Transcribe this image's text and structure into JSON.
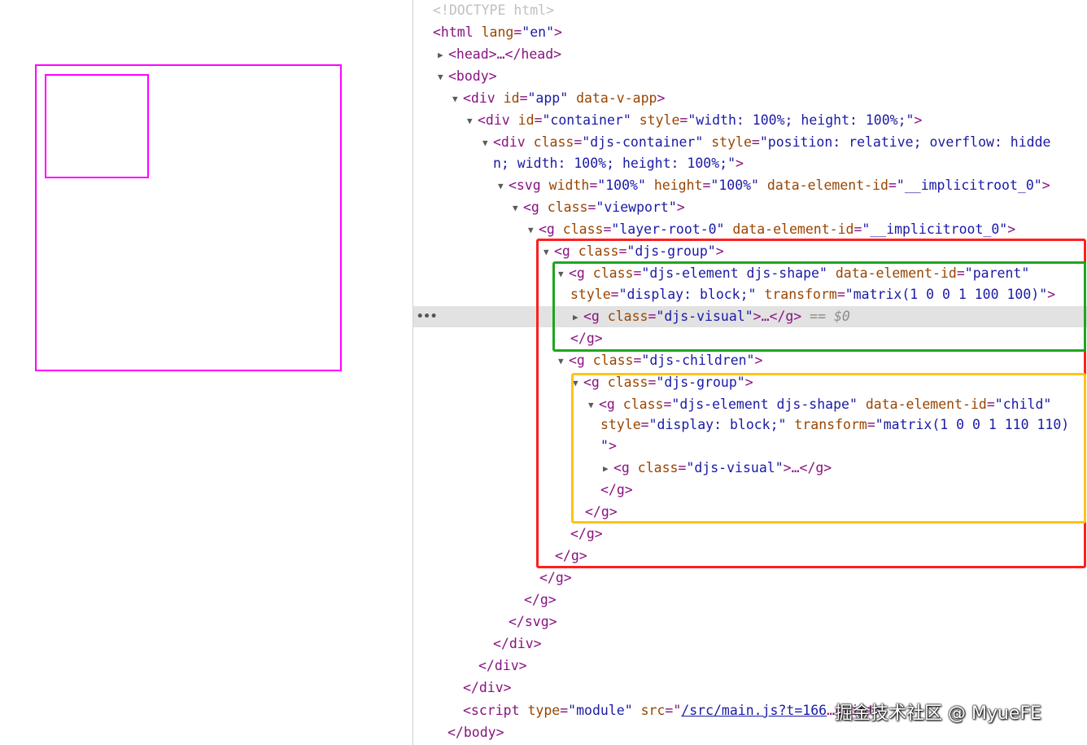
{
  "canvas": {
    "shape_color": "#ff00ff",
    "shapes": [
      "parent",
      "child"
    ]
  },
  "highlight_colors": {
    "red": "#ff1f1f",
    "green": "#1fa51f",
    "yellow": "#ffc21a"
  },
  "dom": {
    "doctype": "<!DOCTYPE html>",
    "l_html_open": "<html",
    "l_html_lang_name": " lang",
    "l_html_lang_val": "\"en\"",
    "l_html_close": ">",
    "head_open": "<head>",
    "head_ellipsis": "…",
    "head_close": "</head>",
    "body_open": "<body>",
    "app_open": "<div",
    "app_id_name": " id",
    "app_id_val": "\"app\"",
    "app_vapp": " data-v-app",
    "app_close": ">",
    "cont_open": "<div",
    "cont_id_name": " id",
    "cont_id_val": "\"container\"",
    "cont_style_name": " style",
    "cont_style_val": "\"width: 100%; height: 100%;\"",
    "cont_close": ">",
    "djsc_open": "<div",
    "djsc_class_name": " class",
    "djsc_class_val": "\"djs-container\"",
    "djsc_style_name": " style",
    "djsc_style_val_a": "\"position: relative; overflow: hidde",
    "djsc_style_val_b": "n; width: 100%; height: 100%;\"",
    "djsc_close": ">",
    "svg_open": "<svg",
    "svg_w_name": " width",
    "svg_w_val": "\"100%\"",
    "svg_h_name": " height",
    "svg_h_val": "\"100%\"",
    "svg_id_name": " data-element-id",
    "svg_id_val": "\"__implicitroot_0\"",
    "svg_close": ">",
    "vp_open": "<g",
    "vp_class_name": " class",
    "vp_class_val": "\"viewport\"",
    "vp_close": ">",
    "lr_open": "<g",
    "lr_class_name": " class",
    "lr_class_val": "\"layer-root-0\"",
    "lr_id_name": " data-element-id",
    "lr_id_val": "\"__implicitroot_0\"",
    "lr_close": ">",
    "grp_open": "<g",
    "grp_class_name": " class",
    "grp_class_val": "\"djs-group\"",
    "grp_close": ">",
    "par_open": "<g",
    "par_class_name": " class",
    "par_class_val": "\"djs-element djs-shape\"",
    "par_id_name": " data-element-id",
    "par_id_val": "\"parent\"",
    "par_style_name": "style",
    "par_style_val": "\"display: block;\"",
    "par_tr_name": " transform",
    "par_tr_val": "\"matrix(1 0 0 1 100 100)\"",
    "par_close": ">",
    "vis_open": "<g",
    "vis_class_name": " class",
    "vis_class_val": "\"djs-visual\"",
    "vis_rest": ">…</g>",
    "vis_eq": " == $0",
    "g_close": "</g>",
    "ch_open": "<g",
    "ch_class_name": " class",
    "ch_class_val": "\"djs-children\"",
    "ch_close": ">",
    "cgrp_open": "<g",
    "cgrp_class_name": " class",
    "cgrp_class_val": "\"djs-group\"",
    "cgrp_close": ">",
    "chi_open": "<g",
    "chi_class_name": " class",
    "chi_class_val": "\"djs-element djs-shape\"",
    "chi_id_name": " data-element-id",
    "chi_id_val": "\"child\"",
    "chi_style_name": "style",
    "chi_style_val": "\"display: block;\"",
    "chi_tr_name": " transform",
    "chi_tr_val": "\"matrix(1 0 0 1 110 110)",
    "chi_tr_end": "\"",
    "chi_close": ">",
    "cvis_open": "<g",
    "cvis_class_name": " class",
    "cvis_class_val": "\"djs-visual\"",
    "cvis_rest": ">…</g>",
    "svg_end": "</svg>",
    "div_end": "</div>",
    "scr_open": "<script",
    "scr_type_name": " type",
    "scr_type_val": "\"module\"",
    "scr_src_name": " src",
    "scr_src_val": "/src/main.js?t=166",
    "scr_rest": "…cript>",
    "body_end": "</body>"
  },
  "watermark": "掘金技术社区 @ MyueFE"
}
